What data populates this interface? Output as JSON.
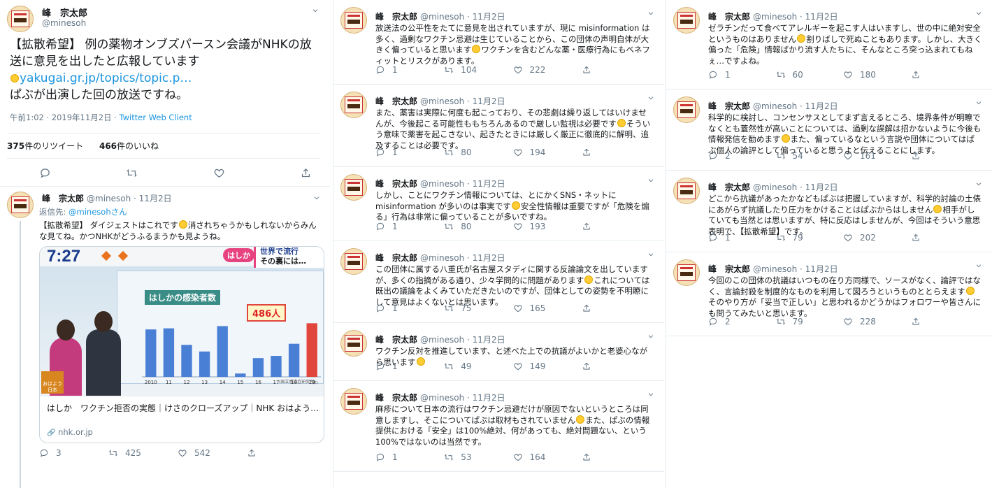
{
  "author": {
    "name": "峰　宗太郎",
    "handle": "@minesoh"
  },
  "main_tweet": {
    "text_a": "【拡散希望】 例の薬物オンブズパースン会議がNHKの放送に意見を出したと広報しています",
    "link": "yakugai.gr.jp/topics/topic.p…",
    "text_b": "ぱぶが出演した回の放送ですね。",
    "time": "午前1:02 · 2019年11月2日",
    "client": "Twitter Web Client",
    "retweets_count": "375",
    "retweets_label": "件のリツイート",
    "likes_count": "466",
    "likes_label": "件のいいね"
  },
  "reply1": {
    "meta": "@minesoh · 11月2日",
    "reply_to_label": "返信先: ",
    "reply_to": "@minesohさん",
    "text_a": "【拡散希望】 ダイジェストはこれです",
    "text_b": "消されちゃうかもしれないからみんな見てね。かつNHKがどうふるまうかも見ようね。",
    "card": {
      "clock": "7:27",
      "banner_tag": "はしか",
      "banner_a": "世界で流行",
      "banner_b": "その裏には…",
      "chart_title": "はしかの感染者数",
      "callout": "486人",
      "chart_note": "(国立感染症研究所)",
      "unit": "(年)",
      "badge": "おはよう日本",
      "title": "はしか　ワクチン拒否の実態｜けさのクローズアップ｜NHK おはよう…",
      "url": "nhk.or.jp"
    },
    "counts": {
      "reply": "3",
      "retweet": "425",
      "like": "542"
    }
  },
  "chart_data": {
    "type": "bar",
    "title": "はしかの感染者数",
    "categories": [
      "2010",
      "11",
      "12",
      "13",
      "14",
      "15",
      "16",
      "17",
      "18",
      "19"
    ],
    "values": [
      430,
      440,
      290,
      230,
      460,
      30,
      170,
      190,
      300,
      486
    ],
    "highlight_label": "486人"
  },
  "col2": [
    {
      "meta": "@minesoh · 11月2日",
      "text_a": "放送法の公平性をたてに意見を出されていますが、現に misinformation は多く、過剰なワクチン忌避は生じていることから、この団体の声明自体が大きく偏っていると思います",
      "text_b": "ワクチンを含むどんな薬・医療行為にもベネフィットとリスクがあります。",
      "reply": "1",
      "retweet": "104",
      "like": "222"
    },
    {
      "meta": "@minesoh · 11月2日",
      "text_a": "また、薬害は実際に何度も起こっており、その悲劇は繰り返してはいけませんが、今後起こる可能性ももちろんあるので厳しい監視は必要です",
      "text_b": "そういう意味で薬害を起こさない、起きたときには厳しく厳正に徹底的に解明、追及することは必要です。",
      "reply": "1",
      "retweet": "80",
      "like": "194"
    },
    {
      "meta": "@minesoh · 11月2日",
      "text_a": "しかし、ことにワクチン情報については、とにかくSNS・ネットにmisinformation が多いのは事実です",
      "text_b": "安全性情報は重要ですが「危険を煽る」行為は非常に偏っていることが多いですね。",
      "reply": "1",
      "retweet": "80",
      "like": "193"
    },
    {
      "meta": "@minesoh · 11月2日",
      "text_a": "この団体に属する八重氏が名古屋スタディに関する反論論文を出していますが、多くの指摘がある通り、少々学問的に問題があります",
      "text_b": "これについては既出の議論をよくみていただきたいのですが、団体としての姿勢を不明瞭にして意見はよくないとは思います。",
      "reply": "1",
      "retweet": "75",
      "like": "165"
    },
    {
      "meta": "@minesoh · 11月2日",
      "text_a": "ワクチン反対を推進しています、と述べた上での抗議がよいかと老婆心ながら思います",
      "text_b": "",
      "reply": "1",
      "retweet": "49",
      "like": "149"
    },
    {
      "meta": "@minesoh · 11月2日",
      "text_a": "麻疹について日本の流行はワクチン忌避だけが原因でないというところは同意しますし、そこについてぱぶは取材もされていません",
      "text_b": "また、ぱぶの情報提供における「安全」は100%絶対、何があっても、絶対問題ない、という100%ではないのは当然です。",
      "reply": "1",
      "retweet": "53",
      "like": "164"
    }
  ],
  "col3": [
    {
      "meta": "@minesoh · 11月2日",
      "text_a": "ゼラチンだって食べてアレルギーを起こす人はいますし、世の中に絶対安全というものはありません",
      "text_b": "割りばしで死ぬこともあります。しかし、大きく偏った「危険」情報ばかり流す人たちに、そんなところ突っ込まれてもねぇ…ですよね。",
      "reply": "1",
      "retweet": "60",
      "like": "180"
    },
    {
      "meta": "@minesoh · 11月2日",
      "text_a": "科学的に検討し、コンセンサスとしてまず言えるところ、境界条件が明瞭でなくとも蓋然性が高いことについては、過剰な誤解は招かないように今後も情報発信を勧めます",
      "text_b": "また、偏っているなという言説や団体についてはぱぶ個人の論評として偏っていると思うよと伝えることにします。",
      "reply": "2",
      "retweet": "54",
      "like": "161"
    },
    {
      "meta": "@minesoh · 11月2日",
      "text_a": "どこから抗議があったかなどもぱぶは把握していますが、科学的討論の土俵にあがらず抗議したり圧力をかけることはぱぶからはしません",
      "text_b": "相手がしていても当然とは思いますが、特に反応はしませんが、今回はそういう意思表明で、【拡散希望】です。",
      "reply": "1",
      "retweet": "79",
      "like": "202"
    },
    {
      "meta": "@minesoh · 11月2日",
      "text_a": "今回のこの団体の抗議はいつもの在り方同様で、ソースがなく、論評ではなく、言論封殺を制度的なものを利用して図ろうというものととらえます",
      "text_b": "そのやり方が「妥当で正しい」と思われるかどうかはフォロワーや皆さんにも問うてみたいと思います。",
      "reply": "2",
      "retweet": "79",
      "like": "228"
    }
  ]
}
